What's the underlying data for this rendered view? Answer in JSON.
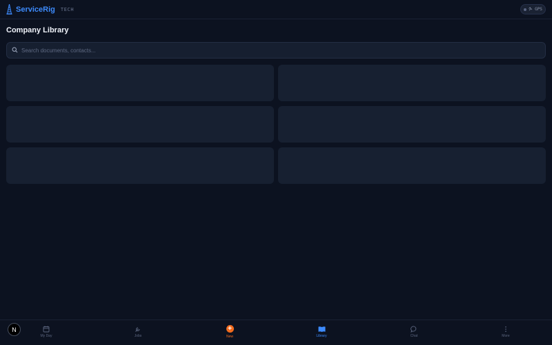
{
  "app": {
    "name": "ServiceRig",
    "tag": "TECH"
  },
  "header": {
    "gps_label": "GPS"
  },
  "page": {
    "title": "Company Library"
  },
  "search": {
    "placeholder": "Search documents, contacts..."
  },
  "nav": {
    "items": [
      {
        "label": "My Day",
        "icon": "calendar-icon"
      },
      {
        "label": "Jobs",
        "icon": "wrench-icon"
      },
      {
        "label": "New",
        "icon": "plus-circle-icon"
      },
      {
        "label": "Library",
        "icon": "book-icon",
        "active": true
      },
      {
        "label": "Chat",
        "icon": "chat-bubble-icon"
      },
      {
        "label": "More",
        "icon": "more-vertical-icon"
      }
    ]
  },
  "avatar": {
    "initial": "N"
  },
  "colors": {
    "accent": "#3d8bfd",
    "new": "#f26b1d",
    "background": "#0c1220",
    "card": "#172031"
  }
}
